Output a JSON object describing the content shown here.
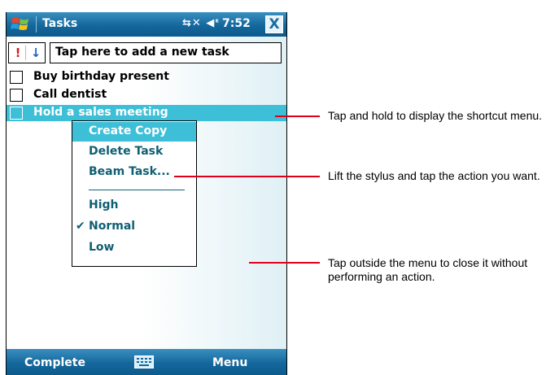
{
  "titlebar": {
    "app_title": "Tasks",
    "status_icons": "⇆✕ ◀ᵋ",
    "clock": "7:52",
    "close_label": "X"
  },
  "entry": {
    "priority_high_glyph": "!",
    "priority_low_glyph": "↓",
    "placeholder": "Tap here to add a new task"
  },
  "tasks": [
    {
      "label": "Buy birthday present",
      "checked": false,
      "selected": false
    },
    {
      "label": "Call dentist",
      "checked": false,
      "selected": false
    },
    {
      "label": "Hold a sales meeting",
      "checked": false,
      "selected": true
    }
  ],
  "context_menu": {
    "items": [
      {
        "label": "Create Copy",
        "highlighted": true
      },
      {
        "label": "Delete Task",
        "highlighted": false
      },
      {
        "label": "Beam Task...",
        "highlighted": false
      }
    ],
    "priority_items": [
      {
        "label": "High",
        "checked": false
      },
      {
        "label": "Normal",
        "checked": true,
        "check_glyph": "✔"
      },
      {
        "label": "Low",
        "checked": false
      }
    ]
  },
  "softkeys": {
    "left": "Complete",
    "right": "Menu",
    "center_icon": "keyboard-icon"
  },
  "callouts": [
    {
      "text": "Tap and hold to display the shortcut menu."
    },
    {
      "text": "Lift the stylus and tap the action you want."
    },
    {
      "text": "Tap outside the menu to close it without performing an action."
    }
  ],
  "colors": {
    "titlebar": "#14679c",
    "selection": "#3dbfd8",
    "menu_text": "#0f5f73",
    "callout_line": "#e0001b",
    "priority_high": "#d42020",
    "priority_low": "#1a62c8"
  }
}
